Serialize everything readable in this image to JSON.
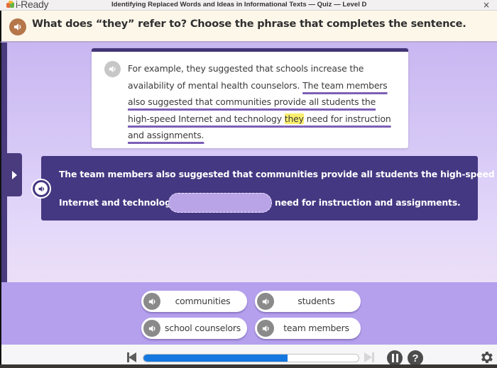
{
  "app": {
    "logo_text": "i-Ready",
    "lesson_title": "Identifying Replaced Words and Ideas in Informational Texts — Quiz — Level D",
    "close_label": "×"
  },
  "prompt": {
    "audio_icon": "speaker-icon",
    "text": "What does “they” refer to? Choose the phrase that completes the sentence."
  },
  "passage": {
    "audio_icon": "speaker-icon",
    "segments": [
      "For example, they suggested that schools increase the availability of mental health counselors. ",
      "The team members also suggested that communities provide all students the high-speed Internet and technology ",
      "they",
      " need for instruction and assignments."
    ],
    "highlighted_word": "they"
  },
  "sentence": {
    "line1": "The team members also suggested that communities provide all students the high-speed",
    "line2_before": "Internet and technology",
    "blank_value": "",
    "line2_after": "need for instruction and assignments."
  },
  "side_tab": {
    "icon": "play-triangle-icon"
  },
  "answers": [
    {
      "label": "communities"
    },
    {
      "label": "students"
    },
    {
      "label": "school counselors"
    },
    {
      "label": "team members"
    }
  ],
  "controls": {
    "progress_percent": 67,
    "help_label": "?",
    "colors": {
      "progress": "#1478e0",
      "sentence_card": "#453882",
      "prompt_audio": "#b5764a",
      "highlight": "#fbef6e"
    }
  }
}
